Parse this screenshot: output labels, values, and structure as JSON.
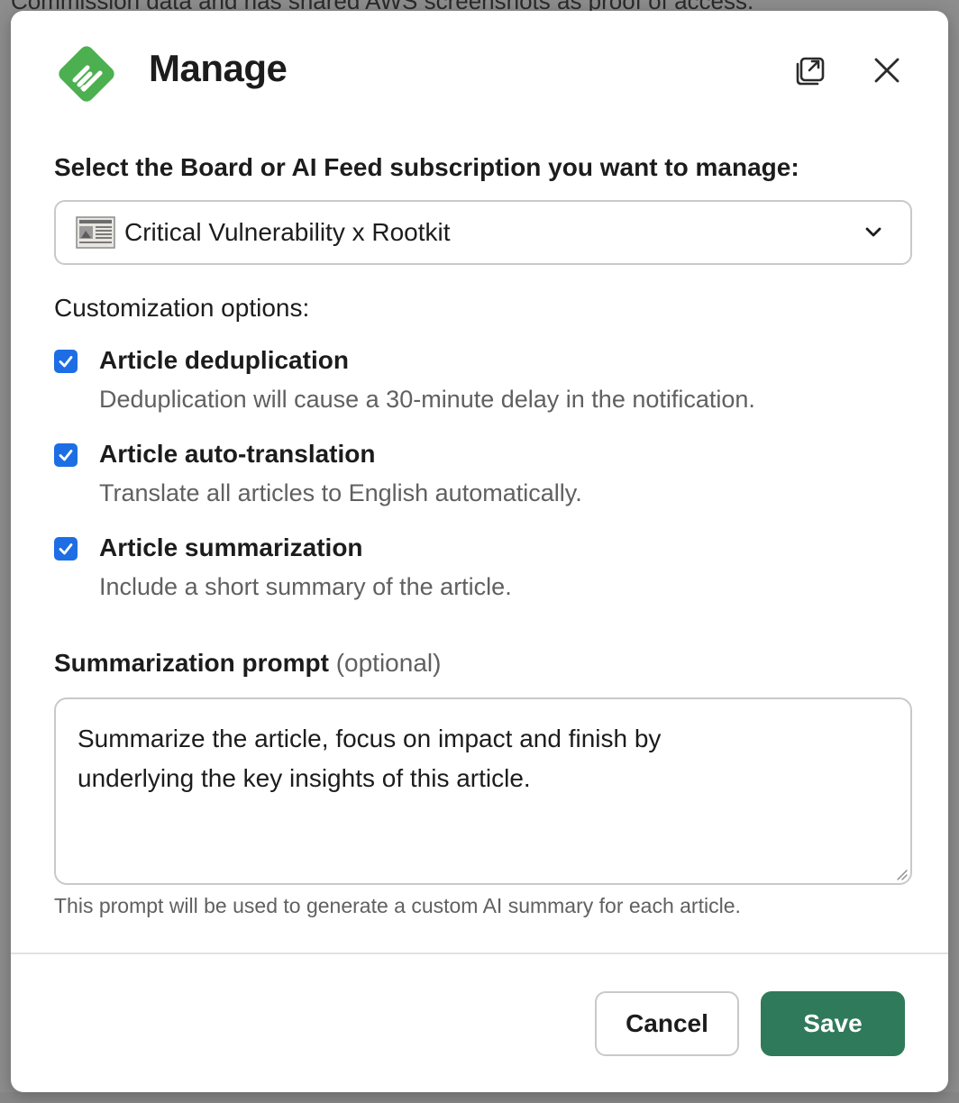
{
  "background": {
    "top_text": "Commission data and has shared AWS screenshots as proof of access."
  },
  "modal": {
    "title": "Manage",
    "select_label": "Select the Board or AI Feed subscription you want to manage:",
    "select_value": "Critical Vulnerability x Rootkit",
    "customization_label": "Customization options:",
    "options": [
      {
        "title": "Article deduplication",
        "description": "Deduplication will cause a 30-minute delay in the notification.",
        "checked": true
      },
      {
        "title": "Article auto-translation",
        "description": "Translate all articles to English automatically.",
        "checked": true
      },
      {
        "title": "Article summarization",
        "description": "Include a short summary of the article.",
        "checked": true
      }
    ],
    "prompt_label": "Summarization prompt",
    "prompt_optional": "(optional)",
    "prompt_value": "Summarize the article, focus on impact and finish by underlying the key insights of this article.",
    "prompt_hint": "This prompt will be used to generate a custom AI summary for each article.",
    "cancel_label": "Cancel",
    "save_label": "Save"
  },
  "colors": {
    "brand_green": "#4CB050",
    "checkbox_blue": "#1D6EE4",
    "save_green": "#2F7A5A"
  },
  "icons": {
    "logo": "feedly-logo-icon",
    "popout": "popout-window-icon",
    "close": "close-icon",
    "select_item": "newspaper-icon",
    "chevron": "chevron-down-icon",
    "checkbox": "checkmark-icon"
  }
}
